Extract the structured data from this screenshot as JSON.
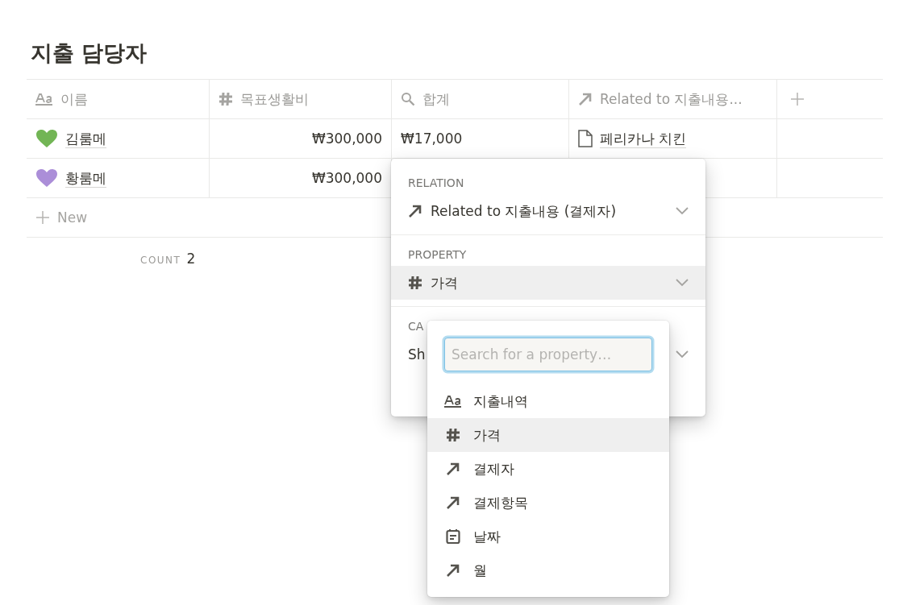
{
  "page": {
    "title": "지출 담당자"
  },
  "table": {
    "columns": [
      {
        "kind": "title",
        "label": "이름"
      },
      {
        "kind": "number",
        "label": "목표생활비"
      },
      {
        "kind": "rollup",
        "label": "합계"
      },
      {
        "kind": "relation",
        "label": "Related to 지출내용..."
      }
    ],
    "rows": [
      {
        "name": "김룸메",
        "color": "#72b555",
        "goal": "₩300,000",
        "total": "₩17,000",
        "related": [
          {
            "title": "페리카나 치킨"
          }
        ]
      },
      {
        "name": "황룸메",
        "color": "#ab8ed8",
        "goal": "₩300,000"
      }
    ],
    "new_row": {
      "label": "New"
    },
    "footer": {
      "label": "COUNT",
      "value": "2"
    }
  },
  "rollup_menu": {
    "sections": [
      {
        "heading": "RELATION",
        "value": "Related to 지출내용 (결제자)",
        "kind": "relation",
        "highlighted": false
      },
      {
        "heading": "PROPERTY",
        "value": "가격",
        "kind": "number",
        "highlighted": true
      },
      {
        "heading": "CA",
        "value": "Sh",
        "kind": "none",
        "highlighted": false
      }
    ]
  },
  "property_picker": {
    "search": {
      "placeholder": "Search for a property…"
    },
    "items": [
      {
        "kind": "title",
        "label": "지출내역",
        "selected": false
      },
      {
        "kind": "number",
        "label": "가격",
        "selected": true
      },
      {
        "kind": "relation",
        "label": "결제자",
        "selected": false
      },
      {
        "kind": "relation",
        "label": "결제항목",
        "selected": false
      },
      {
        "kind": "date",
        "label": "날짜",
        "selected": false
      },
      {
        "kind": "relation",
        "label": "월",
        "selected": false
      }
    ]
  }
}
